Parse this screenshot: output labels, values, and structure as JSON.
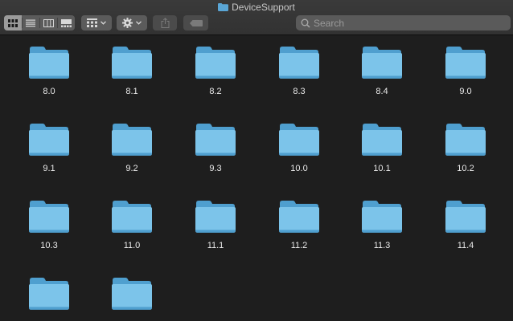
{
  "window": {
    "title": "DeviceSupport"
  },
  "toolbar": {
    "view_icons": [
      "icon-view-icon",
      "list-view-icon",
      "column-view-icon",
      "gallery-view-icon"
    ],
    "search_placeholder": "Search"
  },
  "colors": {
    "folder_light": "#7cc4ea",
    "folder_dark": "#4f9fcf",
    "toolbar_bg": "#363636",
    "content_bg": "#1e1e1e"
  },
  "folders": [
    {
      "label": "8.0"
    },
    {
      "label": "8.1"
    },
    {
      "label": "8.2"
    },
    {
      "label": "8.3"
    },
    {
      "label": "8.4"
    },
    {
      "label": "9.0"
    },
    {
      "label": "9.1"
    },
    {
      "label": "9.2"
    },
    {
      "label": "9.3"
    },
    {
      "label": "10.0"
    },
    {
      "label": "10.1"
    },
    {
      "label": "10.2"
    },
    {
      "label": "10.3"
    },
    {
      "label": "11.0"
    },
    {
      "label": "11.1"
    },
    {
      "label": "11.2"
    },
    {
      "label": "11.3"
    },
    {
      "label": "11.4"
    },
    {
      "label": ""
    },
    {
      "label": ""
    }
  ]
}
